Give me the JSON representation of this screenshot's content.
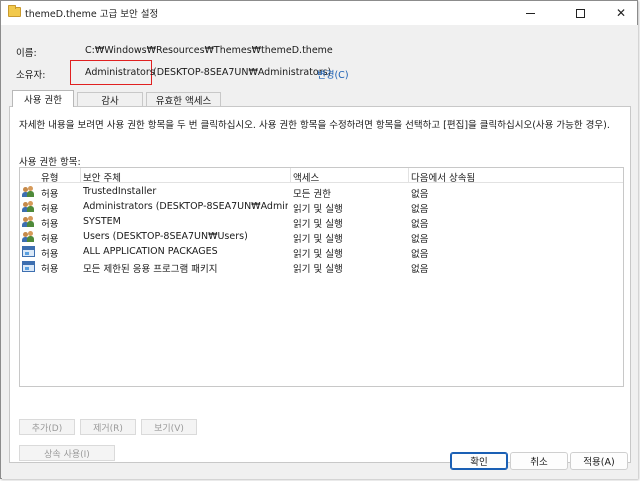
{
  "window": {
    "title": "themeD.theme 고급 보안 설정",
    "minimize_glyph": "—",
    "maximize_glyph": "☐",
    "close_glyph": "✕"
  },
  "header": {
    "name_label": "이름:",
    "name_value": "C:₩Windows₩Resources₩Themes₩themeD.theme",
    "owner_label": "소유자:",
    "owner_name": "Administrators",
    "owner_account": "(DESKTOP-8SEA7UN₩Administrators)",
    "change_link": "변경(C)",
    "highlight_color": "#e02020"
  },
  "tabs": [
    {
      "label": "사용 권한",
      "active": true
    },
    {
      "label": "감사",
      "active": false
    },
    {
      "label": "유효한 액세스",
      "active": false
    }
  ],
  "permissions": {
    "description": "자세한 내용을 보려면 사용 권한 항목을 두 번 클릭하십시오. 사용 권한 항목을 수정하려면 항목을 선택하고 [편집]을 클릭하십시오(사용 가능한 경우).",
    "entries_label": "사용 권한 항목:",
    "columns": [
      "유형",
      "보안 주체",
      "액세스",
      "다음에서 상속됨"
    ],
    "rows": [
      {
        "icon": "users-icon",
        "type": "허용",
        "principal": "TrustedInstaller",
        "access": "모든 권한",
        "inherited": "없음"
      },
      {
        "icon": "users-icon",
        "type": "허용",
        "principal": "Administrators (DESKTOP-8SEA7UN₩Administ...",
        "access": "읽기 및 실행",
        "inherited": "없음"
      },
      {
        "icon": "users-icon",
        "type": "허용",
        "principal": "SYSTEM",
        "access": "읽기 및 실행",
        "inherited": "없음"
      },
      {
        "icon": "users-icon",
        "type": "허용",
        "principal": "Users (DESKTOP-8SEA7UN₩Users)",
        "access": "읽기 및 실행",
        "inherited": "없음"
      },
      {
        "icon": "package-icon",
        "type": "허용",
        "principal": "ALL APPLICATION PACKAGES",
        "access": "읽기 및 실행",
        "inherited": "없음"
      },
      {
        "icon": "package-icon",
        "type": "허용",
        "principal": "모든 제한된 응용 프로그램 패키지",
        "access": "읽기 및 실행",
        "inherited": "없음"
      }
    ],
    "add_button": "추가(D)",
    "remove_button": "제거(R)",
    "view_button": "보기(V)",
    "disable_inheritance_button": "상속 사용(I)"
  },
  "footer": {
    "ok": "확인",
    "cancel": "취소",
    "apply": "적용(A)"
  }
}
